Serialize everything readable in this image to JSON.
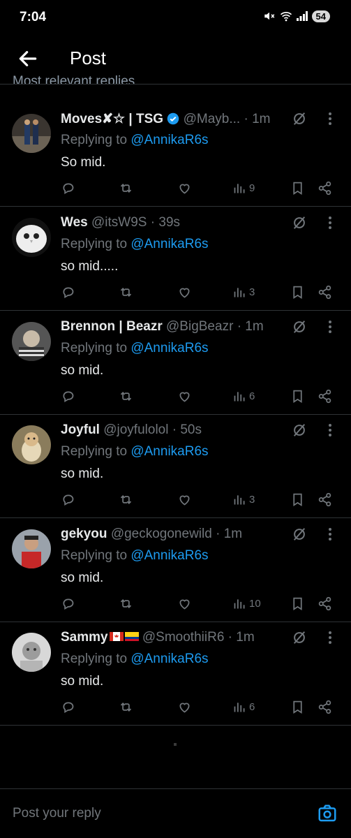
{
  "status_bar": {
    "time": "7:04",
    "battery": "54"
  },
  "header": {
    "title": "Post"
  },
  "peek_text": "Most relevant replies",
  "replies": [
    {
      "name": "Moves✘☆ | TSG",
      "handle": "@Mayb...",
      "time": "· 1m",
      "replying_prefix": "Replying to",
      "replying_to": "@AnnikaR6s",
      "text": "So mid.",
      "views": "9",
      "verified": true
    },
    {
      "name": "Wes",
      "handle": "@itsW9S",
      "time": "· 39s",
      "replying_prefix": "Replying to",
      "replying_to": "@AnnikaR6s",
      "text": "so mid.....",
      "views": "3"
    },
    {
      "name": "Brennon | Beazr",
      "handle": "@BigBeazr",
      "time": "· 1m",
      "replying_prefix": "Replying to",
      "replying_to": "@AnnikaR6s",
      "text": "so mid.",
      "views": "6"
    },
    {
      "name": "Joyful",
      "handle": "@joyfulolol",
      "time": "· 50s",
      "replying_prefix": "Replying to",
      "replying_to": "@AnnikaR6s",
      "text": "so mid.",
      "views": "3"
    },
    {
      "name": "gekyou",
      "handle": "@geckogonewild",
      "time": "· 1m",
      "replying_prefix": "Replying to",
      "replying_to": "@AnnikaR6s",
      "text": "so mid.",
      "views": "10"
    },
    {
      "name": "Sammy",
      "handle": "@SmoothiiR6",
      "time": "· 1m",
      "replying_prefix": "Replying to",
      "replying_to": "@AnnikaR6s",
      "text": "so mid.",
      "views": "6",
      "flags": [
        "canada-flag",
        "colombia-flag"
      ]
    }
  ],
  "composer": {
    "placeholder": "Post your reply"
  },
  "colors": {
    "background": "#000000",
    "link": "#1d9bf0",
    "muted": "#71767b",
    "divider": "#2f3336"
  }
}
